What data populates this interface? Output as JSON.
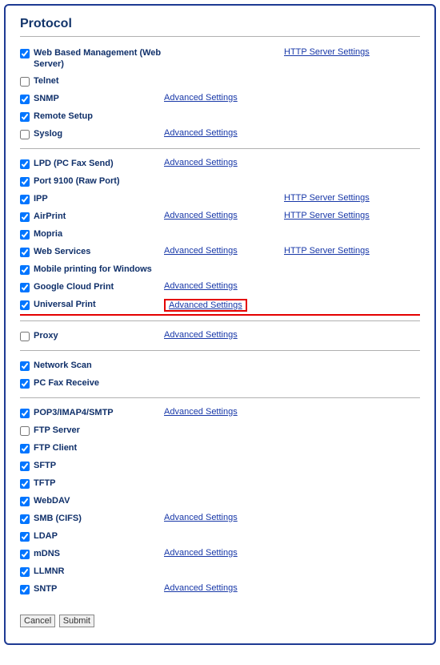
{
  "title": "Protocol",
  "links": {
    "advanced": "Advanced Settings",
    "http": "HTTP Server Settings"
  },
  "buttons": {
    "cancel": "Cancel",
    "submit": "Submit"
  },
  "groups": [
    {
      "rows": [
        {
          "label": "Web Based Management (Web Server)",
          "checked": true,
          "adv": false,
          "http": true
        },
        {
          "label": "Telnet",
          "checked": false,
          "adv": false,
          "http": false
        },
        {
          "label": "SNMP",
          "checked": true,
          "adv": true,
          "http": false
        },
        {
          "label": "Remote Setup",
          "checked": true,
          "adv": false,
          "http": false
        },
        {
          "label": "Syslog",
          "checked": false,
          "adv": true,
          "http": false
        }
      ]
    },
    {
      "rows": [
        {
          "label": "LPD (PC Fax Send)",
          "checked": true,
          "adv": true,
          "http": false
        },
        {
          "label": "Port 9100 (Raw Port)",
          "checked": true,
          "adv": false,
          "http": false
        },
        {
          "label": "IPP",
          "checked": true,
          "adv": false,
          "http": true
        },
        {
          "label": "AirPrint",
          "checked": true,
          "adv": true,
          "http": true
        },
        {
          "label": "Mopria",
          "checked": true,
          "adv": false,
          "http": false
        },
        {
          "label": "Web Services",
          "checked": true,
          "adv": true,
          "http": true
        },
        {
          "label": "Mobile printing for Windows",
          "checked": true,
          "adv": false,
          "http": false
        },
        {
          "label": "Google Cloud Print",
          "checked": true,
          "adv": true,
          "http": false
        },
        {
          "label": "Universal Print",
          "checked": true,
          "adv": true,
          "http": false,
          "highlight": true
        }
      ]
    },
    {
      "rows": [
        {
          "label": "Proxy",
          "checked": false,
          "adv": true,
          "http": false
        }
      ]
    },
    {
      "rows": [
        {
          "label": "Network Scan",
          "checked": true,
          "adv": false,
          "http": false
        },
        {
          "label": "PC Fax Receive",
          "checked": true,
          "adv": false,
          "http": false
        }
      ]
    },
    {
      "rows": [
        {
          "label": "POP3/IMAP4/SMTP",
          "checked": true,
          "adv": true,
          "http": false
        },
        {
          "label": "FTP Server",
          "checked": false,
          "adv": false,
          "http": false
        },
        {
          "label": "FTP Client",
          "checked": true,
          "adv": false,
          "http": false
        },
        {
          "label": "SFTP",
          "checked": true,
          "adv": false,
          "http": false
        },
        {
          "label": "TFTP",
          "checked": true,
          "adv": false,
          "http": false
        },
        {
          "label": "WebDAV",
          "checked": true,
          "adv": false,
          "http": false
        },
        {
          "label": "SMB (CIFS)",
          "checked": true,
          "adv": true,
          "http": false
        },
        {
          "label": "LDAP",
          "checked": true,
          "adv": false,
          "http": false
        },
        {
          "label": "mDNS",
          "checked": true,
          "adv": true,
          "http": false
        },
        {
          "label": "LLMNR",
          "checked": true,
          "adv": false,
          "http": false
        },
        {
          "label": "SNTP",
          "checked": true,
          "adv": true,
          "http": false
        }
      ]
    }
  ]
}
